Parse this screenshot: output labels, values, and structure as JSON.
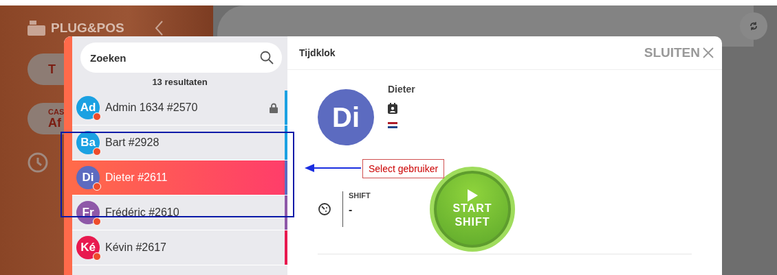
{
  "background": {
    "logo": "PLUG&POS",
    "pill_1": "T",
    "pill_2_label": "CAS",
    "pill_2_value": "Af"
  },
  "search": {
    "placeholder": "Zoeken"
  },
  "result_count": "13 resultaten",
  "users": [
    {
      "initials": "Ad",
      "name": "Admin 1634 #2570",
      "color": "#1ba1e2",
      "locked": true,
      "selected": false
    },
    {
      "initials": "Ba",
      "name": "Bart #2928",
      "color": "#1ba1e2",
      "locked": false,
      "selected": false
    },
    {
      "initials": "Di",
      "name": "Dieter #2611",
      "color": "#5c6bc0",
      "locked": false,
      "selected": true
    },
    {
      "initials": "Fr",
      "name": "Frédéric #2610",
      "color": "#8e58a8",
      "locked": false,
      "selected": false
    },
    {
      "initials": "Ké",
      "name": "Kévin #2617",
      "color": "#e8194f",
      "locked": false,
      "selected": false
    }
  ],
  "modal": {
    "title": "Tijdklok",
    "close": "SLUITEN"
  },
  "detail": {
    "initials": "Di",
    "name": "Dieter",
    "shift_label": "SHIFT",
    "shift_value": "-",
    "start_button": [
      "START",
      "SHIFT"
    ]
  },
  "annotation": {
    "label": "Select gebruiker"
  }
}
